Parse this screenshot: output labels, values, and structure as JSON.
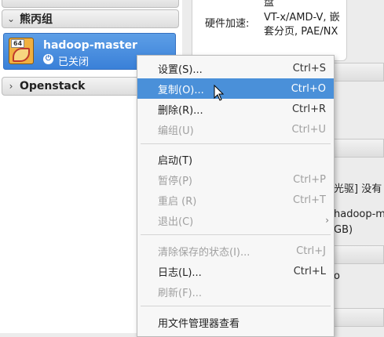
{
  "groups": [
    {
      "name": "熊丙组",
      "expanded": true
    },
    {
      "name": "Openstack",
      "expanded": false
    }
  ],
  "vm": {
    "name": "hadoop-master",
    "status": "已关闭",
    "arch_badge": "64"
  },
  "details": {
    "accel_label": "硬件加速:",
    "accel_value": "VT-x/AMD-V, 嵌套分页, PAE/NX",
    "top_fragment": "盘",
    "fragment_1": "光驱] 没有",
    "fragment_2": "hadoop-m",
    "fragment_3": "GB)",
    "fragment_4": "o"
  },
  "context_menu": {
    "items": [
      {
        "label": "设置(S)...",
        "shortcut": "Ctrl+S",
        "state": "normal"
      },
      {
        "label": "复制(O)...",
        "shortcut": "Ctrl+O",
        "state": "highlight"
      },
      {
        "label": "删除(R)...",
        "shortcut": "Ctrl+R",
        "state": "normal"
      },
      {
        "label": "编组(U)",
        "shortcut": "Ctrl+U",
        "state": "disabled"
      },
      {
        "label": "启动(T)",
        "shortcut": "",
        "state": "normal"
      },
      {
        "label": "暂停(P)",
        "shortcut": "Ctrl+P",
        "state": "disabled"
      },
      {
        "label": "重启 (R)",
        "shortcut": "Ctrl+T",
        "state": "disabled"
      },
      {
        "label": "退出(C)",
        "shortcut": "",
        "state": "disabled",
        "submenu": true
      },
      {
        "label": "清除保存的状态(I)...",
        "shortcut": "Ctrl+J",
        "state": "disabled"
      },
      {
        "label": "日志(L)...",
        "shortcut": "Ctrl+L",
        "state": "normal"
      },
      {
        "label": "刷新(F)...",
        "shortcut": "",
        "state": "disabled"
      },
      {
        "label": "用文件管理器查看",
        "shortcut": "",
        "state": "normal"
      }
    ]
  },
  "colors": {
    "selection": "#4a90d9",
    "disabled_text": "#a0a0a0"
  }
}
